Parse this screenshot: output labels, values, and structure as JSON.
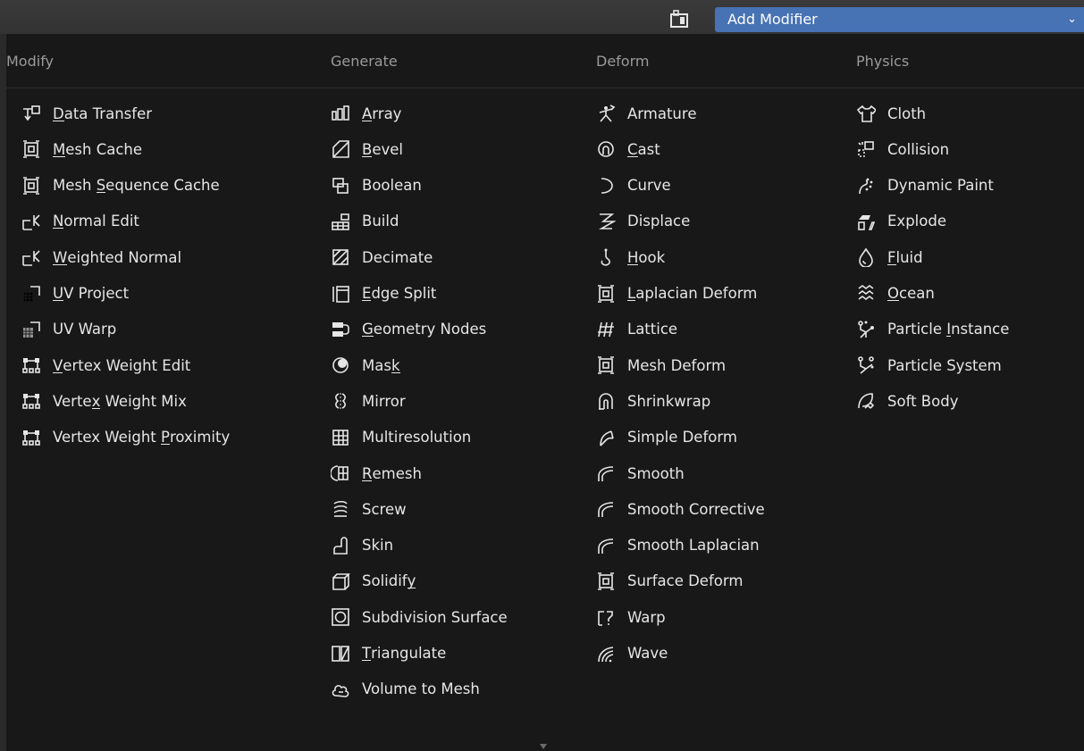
{
  "header": {
    "add_modifier_label": "Add Modifier",
    "icon": "modifier-properties-icon"
  },
  "columns": [
    {
      "title": "Modify",
      "items": [
        {
          "label": "Data Transfer",
          "icon": "data-transfer-icon",
          "ul": 0
        },
        {
          "label": "Mesh Cache",
          "icon": "mesh-cache-icon",
          "ul": 0
        },
        {
          "label": "Mesh Sequence Cache",
          "icon": "mesh-sequence-cache-icon",
          "ul": 5
        },
        {
          "label": "Normal Edit",
          "icon": "normal-edit-icon",
          "ul": 0
        },
        {
          "label": "Weighted Normal",
          "icon": "weighted-normal-icon",
          "ul": 0
        },
        {
          "label": "UV Project",
          "icon": "uv-project-icon",
          "ul": 0
        },
        {
          "label": "UV Warp",
          "icon": "uv-warp-icon",
          "ul": -1
        },
        {
          "label": "Vertex Weight Edit",
          "icon": "vertex-weight-edit-icon",
          "ul": 0
        },
        {
          "label": "Vertex Weight Mix",
          "icon": "vertex-weight-mix-icon",
          "ul": 5
        },
        {
          "label": "Vertex Weight Proximity",
          "icon": "vertex-weight-proximity-icon",
          "ul": 14
        }
      ]
    },
    {
      "title": "Generate",
      "items": [
        {
          "label": "Array",
          "icon": "array-icon",
          "ul": 0
        },
        {
          "label": "Bevel",
          "icon": "bevel-icon",
          "ul": 0
        },
        {
          "label": "Boolean",
          "icon": "boolean-icon",
          "ul": -1
        },
        {
          "label": "Build",
          "icon": "build-icon",
          "ul": -1
        },
        {
          "label": "Decimate",
          "icon": "decimate-icon",
          "ul": -1
        },
        {
          "label": "Edge Split",
          "icon": "edge-split-icon",
          "ul": 0
        },
        {
          "label": "Geometry Nodes",
          "icon": "geometry-nodes-icon",
          "ul": 0
        },
        {
          "label": "Mask",
          "icon": "mask-icon",
          "ul": 3
        },
        {
          "label": "Mirror",
          "icon": "mirror-icon",
          "ul": -1
        },
        {
          "label": "Multiresolution",
          "icon": "multiresolution-icon",
          "ul": -1
        },
        {
          "label": "Remesh",
          "icon": "remesh-icon",
          "ul": 0
        },
        {
          "label": "Screw",
          "icon": "screw-icon",
          "ul": -1
        },
        {
          "label": "Skin",
          "icon": "skin-icon",
          "ul": -1
        },
        {
          "label": "Solidify",
          "icon": "solidify-icon",
          "ul": 7
        },
        {
          "label": "Subdivision Surface",
          "icon": "subdivision-surface-icon",
          "ul": -1
        },
        {
          "label": "Triangulate",
          "icon": "triangulate-icon",
          "ul": 0
        },
        {
          "label": "Volume to Mesh",
          "icon": "volume-to-mesh-icon",
          "ul": -1
        }
      ]
    },
    {
      "title": "Deform",
      "items": [
        {
          "label": "Armature",
          "icon": "armature-icon",
          "ul": -1
        },
        {
          "label": "Cast",
          "icon": "cast-icon",
          "ul": 0
        },
        {
          "label": "Curve",
          "icon": "curve-icon",
          "ul": -1
        },
        {
          "label": "Displace",
          "icon": "displace-icon",
          "ul": -1
        },
        {
          "label": "Hook",
          "icon": "hook-icon",
          "ul": 0
        },
        {
          "label": "Laplacian Deform",
          "icon": "laplacian-deform-icon",
          "ul": 0
        },
        {
          "label": "Lattice",
          "icon": "lattice-icon",
          "ul": -1
        },
        {
          "label": "Mesh Deform",
          "icon": "mesh-deform-icon",
          "ul": -1
        },
        {
          "label": "Shrinkwrap",
          "icon": "shrinkwrap-icon",
          "ul": -1
        },
        {
          "label": "Simple Deform",
          "icon": "simple-deform-icon",
          "ul": -1
        },
        {
          "label": "Smooth",
          "icon": "smooth-icon",
          "ul": -1
        },
        {
          "label": "Smooth Corrective",
          "icon": "smooth-corrective-icon",
          "ul": -1
        },
        {
          "label": "Smooth Laplacian",
          "icon": "smooth-laplacian-icon",
          "ul": -1
        },
        {
          "label": "Surface Deform",
          "icon": "surface-deform-icon",
          "ul": -1
        },
        {
          "label": "Warp",
          "icon": "warp-icon",
          "ul": -1
        },
        {
          "label": "Wave",
          "icon": "wave-icon",
          "ul": -1
        }
      ]
    },
    {
      "title": "Physics",
      "items": [
        {
          "label": "Cloth",
          "icon": "cloth-icon",
          "ul": -1
        },
        {
          "label": "Collision",
          "icon": "collision-icon",
          "ul": -1
        },
        {
          "label": "Dynamic Paint",
          "icon": "dynamic-paint-icon",
          "ul": -1
        },
        {
          "label": "Explode",
          "icon": "explode-icon",
          "ul": -1
        },
        {
          "label": "Fluid",
          "icon": "fluid-icon",
          "ul": 0
        },
        {
          "label": "Ocean",
          "icon": "ocean-icon",
          "ul": 0
        },
        {
          "label": "Particle Instance",
          "icon": "particle-instance-icon",
          "ul": 9
        },
        {
          "label": "Particle System",
          "icon": "particle-system-icon",
          "ul": -1
        },
        {
          "label": "Soft Body",
          "icon": "soft-body-icon",
          "ul": -1
        }
      ]
    }
  ]
}
